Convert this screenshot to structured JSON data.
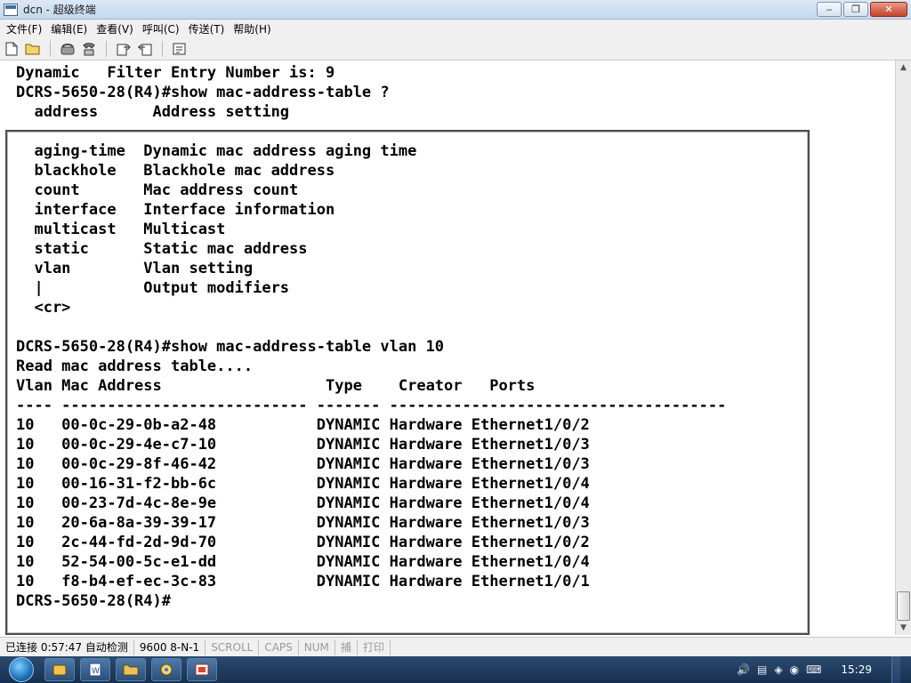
{
  "window": {
    "title": "dcn - 超级终端",
    "minimize": "‒",
    "maximize": "❐",
    "close": "✕"
  },
  "menu": {
    "items": [
      "文件(F)",
      "编辑(E)",
      "查看(V)",
      "呼叫(C)",
      "传送(T)",
      "帮助(H)"
    ]
  },
  "toolbar": {
    "icons": [
      "new-icon",
      "open-icon",
      "call-icon",
      "disconnect-icon",
      "send-icon",
      "receive-icon",
      "properties-icon"
    ]
  },
  "terminal": {
    "lines": [
      "Dynamic   Filter Entry Number is: 9",
      "DCRS-5650-28(R4)#show mac-address-table ?",
      "  address      Address setting",
      "",
      "  aging-time  Dynamic mac address aging time",
      "  blackhole   Blackhole mac address",
      "  count       Mac address count",
      "  interface   Interface information",
      "  multicast   Multicast",
      "  static      Static mac address",
      "  vlan        Vlan setting",
      "  |           Output modifiers",
      "  <cr>",
      "",
      "DCRS-5650-28(R4)#show mac-address-table vlan 10",
      "Read mac address table....",
      "Vlan Mac Address                  Type    Creator   Ports",
      "---- --------------------------- ------- -------------------------------------",
      "10   00-0c-29-0b-a2-48           DYNAMIC Hardware Ethernet1/0/2",
      "10   00-0c-29-4e-c7-10           DYNAMIC Hardware Ethernet1/0/3",
      "10   00-0c-29-8f-46-42           DYNAMIC Hardware Ethernet1/0/3",
      "10   00-16-31-f2-bb-6c           DYNAMIC Hardware Ethernet1/0/4",
      "10   00-23-7d-4c-8e-9e           DYNAMIC Hardware Ethernet1/0/4",
      "10   20-6a-8a-39-39-17           DYNAMIC Hardware Ethernet1/0/3",
      "10   2c-44-fd-2d-9d-70           DYNAMIC Hardware Ethernet1/0/2",
      "10   52-54-00-5c-e1-dd           DYNAMIC Hardware Ethernet1/0/4",
      "10   f8-b4-ef-ec-3c-83           DYNAMIC Hardware Ethernet1/0/1",
      "DCRS-5650-28(R4)#"
    ]
  },
  "scrollbar": {
    "up": "▲",
    "down": "▼"
  },
  "status": {
    "connected": "已连接 0:57:47",
    "detect": "自动检测",
    "settings": "9600 8-N-1",
    "scroll": "SCROLL",
    "caps": "CAPS",
    "num": "NUM",
    "capture": "捕",
    "print": "打印"
  },
  "taskbar": {
    "apps": [
      "explorer",
      "word",
      "folder",
      "app",
      "presentation"
    ],
    "tray_icons": [
      "speaker",
      "network",
      "shield",
      "update",
      "keyboard"
    ],
    "clock": "15:29"
  }
}
